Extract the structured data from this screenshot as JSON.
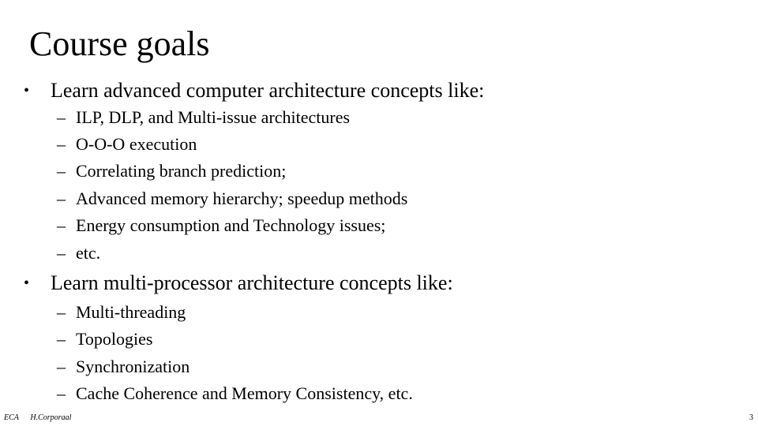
{
  "slide": {
    "title": "Course goals",
    "sections": [
      {
        "bullet": "•",
        "text": "Learn advanced computer architecture concepts like:",
        "items": [
          "ILP, DLP, and Multi-issue architectures",
          "O-O-O execution",
          "Correlating branch prediction;",
          "Advanced memory hierarchy; speedup methods",
          "Energy consumption and Technology issues;",
          "etc."
        ]
      },
      {
        "bullet": "•",
        "text": "Learn multi-processor architecture concepts like:",
        "items": [
          "Multi-threading",
          "Topologies",
          "Synchronization",
          "Cache Coherence and Memory Consistency,   etc."
        ]
      }
    ],
    "dash": "–"
  },
  "footer": {
    "course": "ECA",
    "author": "H.Corporaal",
    "page_number": "3"
  }
}
